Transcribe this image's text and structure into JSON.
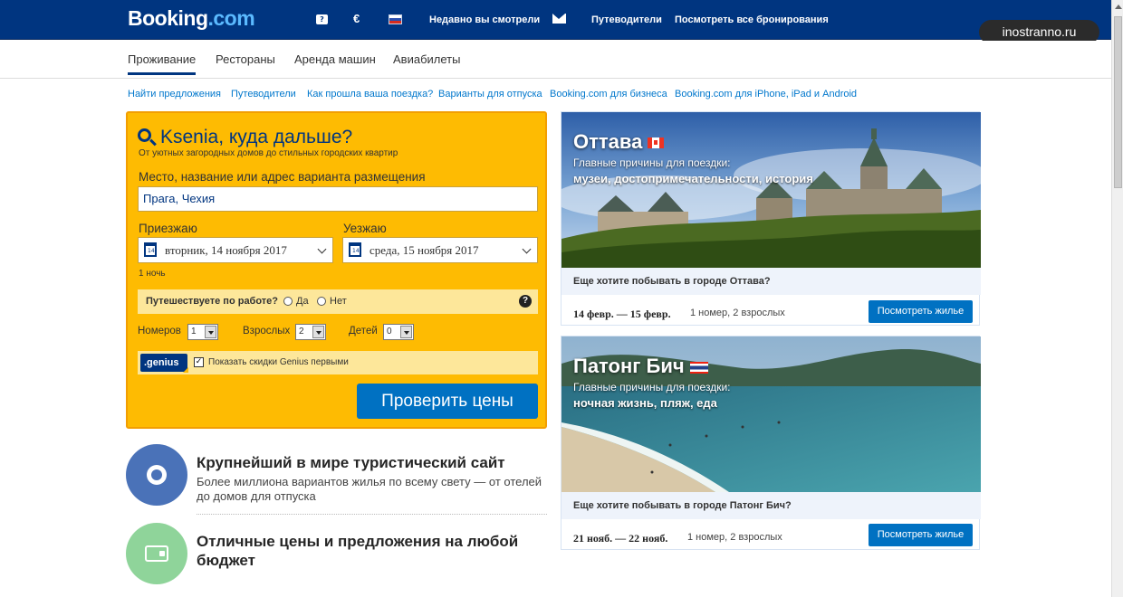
{
  "header": {
    "logo_main": "Booking",
    "logo_suffix": ".com",
    "currency": "€",
    "nav": {
      "recent": "Недавно вы смотрели",
      "guides": "Путеводители",
      "bookings": "Посмотреть все бронирования"
    }
  },
  "watermark": "inostranno.ru",
  "tabs": [
    {
      "label": "Проживание",
      "active": true
    },
    {
      "label": "Рестораны",
      "active": false
    },
    {
      "label": "Аренда машин",
      "active": false
    },
    {
      "label": "Авиабилеты",
      "active": false
    }
  ],
  "sublinks": [
    "Найти предложения",
    "Путеводители",
    "Как прошла ваша поездка?",
    "Варианты для отпуска",
    "Booking.com для бизнеса",
    "Booking.com для iPhone, iPad и Android"
  ],
  "search": {
    "title": "Ksenia, куда дальше?",
    "subtitle": "От уютных загородных домов до стильных городских квартир",
    "destination_label": "Место, название или адрес варианта размещения",
    "destination_value": "Прага, Чехия",
    "checkin_label": "Приезжаю",
    "checkin_value": "вторник, 14 ноября 2017",
    "checkout_label": "Уезжаю",
    "checkout_value": "среда, 15 ноября 2017",
    "nights": "1 ночь",
    "work_question": "Путешествуете по работе?",
    "work_yes": "Да",
    "work_no": "Нет",
    "rooms_label": "Номеров",
    "rooms_value": "1",
    "adults_label": "Взрослых",
    "adults_value": "2",
    "children_label": "Детей",
    "children_value": "0",
    "genius_badge": ".genius",
    "genius_text": "Показать скидки Genius первыми",
    "genius_checked": true,
    "submit": "Проверить цены"
  },
  "features": [
    {
      "title": "Крупнейший в мире туристический сайт",
      "desc_line1": "Более миллиона вариантов жилья по всему свету — от отелей",
      "desc_line2": "до домов для отпуска",
      "color": "#4a72b8"
    },
    {
      "title_line1": "Отличные цены и предложения на любой",
      "title_line2": "бюджет",
      "color": "#8fd49a"
    }
  ],
  "cards": [
    {
      "city": "Оттава",
      "reasons_label": "Главные причины для поездки:",
      "reasons": "музеи, достопримечательности, история",
      "question": "Еще хотите побывать в городе Оттава?",
      "dates": "14 февр. — 15 февр.",
      "guests": "1 номер, 2 взрослых",
      "button": "Посмотреть жилье"
    },
    {
      "city": "Патонг Бич",
      "reasons_label": "Главные причины для поездки:",
      "reasons": "ночная жизнь, пляж, еда",
      "question": "Еще хотите побывать в городе Патонг Бич?",
      "dates": "21 нояб. — 22 нояб.",
      "guests": "1 номер, 2 взрослых",
      "button": "Посмотреть жилье"
    }
  ],
  "colors": {
    "brand_blue": "#003580",
    "search_yellow": "#febb02",
    "button_blue": "#0071c2",
    "link_blue": "#0077cc"
  }
}
